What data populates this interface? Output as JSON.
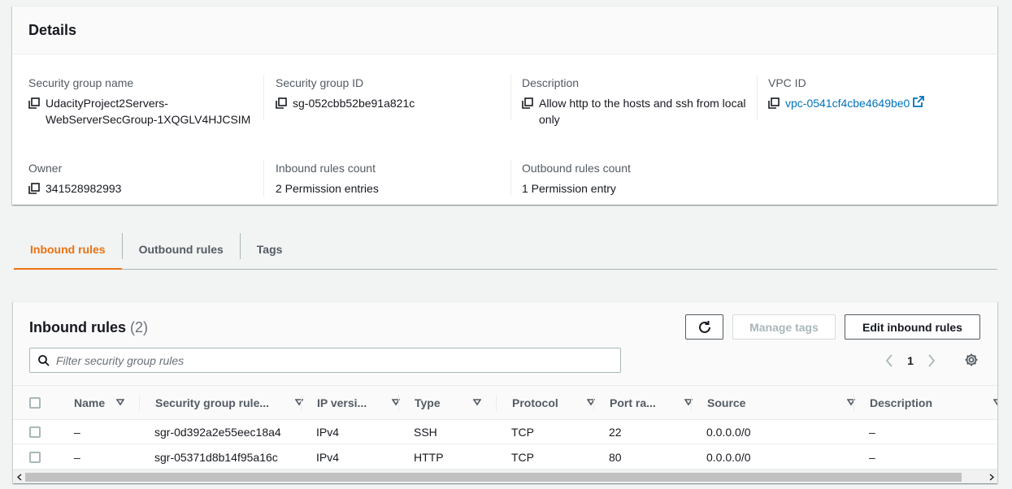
{
  "details": {
    "title": "Details",
    "fields": {
      "sg_name": {
        "label": "Security group name",
        "value": "UdacityProject2Servers-WebServerSecGroup-1XQGLV4HJCSIM"
      },
      "sg_id": {
        "label": "Security group ID",
        "value": "sg-052cbb52be91a821c"
      },
      "description": {
        "label": "Description",
        "value": "Allow http to the hosts and ssh from local only"
      },
      "vpc_id": {
        "label": "VPC ID",
        "value": "vpc-0541cf4cbe4649be0"
      },
      "owner": {
        "label": "Owner",
        "value": "341528982993"
      },
      "inbound_count": {
        "label": "Inbound rules count",
        "value": "2 Permission entries"
      },
      "outbound_count": {
        "label": "Outbound rules count",
        "value": "1 Permission entry"
      }
    }
  },
  "tabs": [
    {
      "label": "Inbound rules",
      "active": true
    },
    {
      "label": "Outbound rules",
      "active": false
    },
    {
      "label": "Tags",
      "active": false
    }
  ],
  "rules": {
    "title": "Inbound rules",
    "count": "(2)",
    "manage_tags_label": "Manage tags",
    "edit_label": "Edit inbound rules",
    "filter_placeholder": "Filter security group rules",
    "page": "1",
    "columns": [
      "Name",
      "Security group rule...",
      "IP versi...",
      "Type",
      "Protocol",
      "Port ra...",
      "Source",
      "Description"
    ],
    "rows": [
      {
        "name": "–",
        "rule_id": "sgr-0d392a2e55eec18a4",
        "ip_version": "IPv4",
        "type": "SSH",
        "protocol": "TCP",
        "port_range": "22",
        "source": "0.0.0.0/0",
        "description": "–"
      },
      {
        "name": "–",
        "rule_id": "sgr-05371d8b14f95a16c",
        "ip_version": "IPv4",
        "type": "HTTP",
        "protocol": "TCP",
        "port_range": "80",
        "source": "0.0.0.0/0",
        "description": "–"
      }
    ]
  },
  "colors": {
    "accent": "#ec7211",
    "link": "#0073bb",
    "text": "#16191f",
    "muted": "#545b64"
  }
}
